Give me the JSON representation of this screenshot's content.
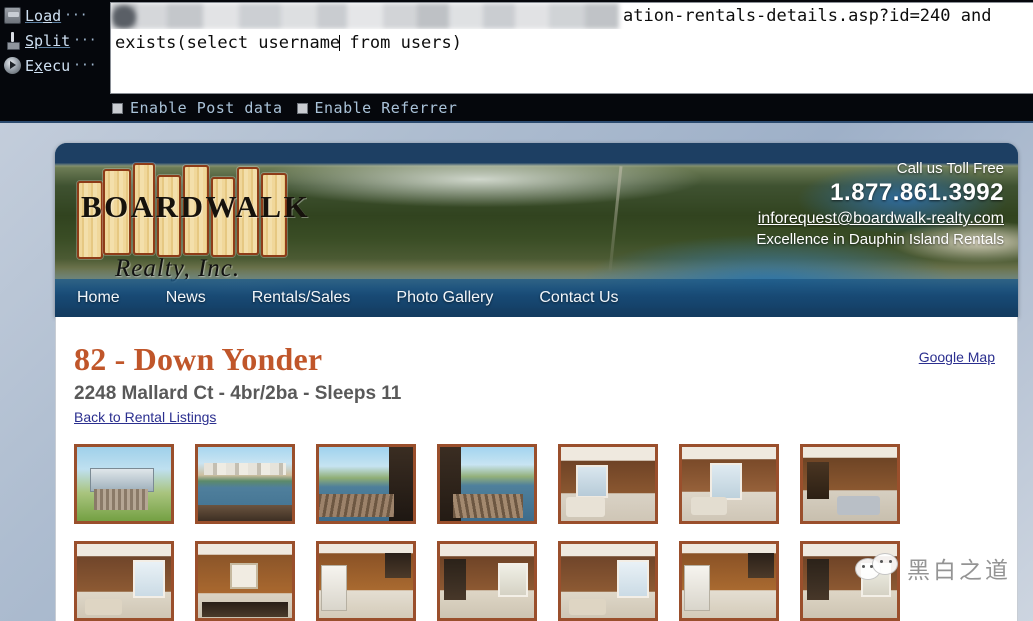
{
  "tool": {
    "menu": [
      {
        "id": "load",
        "label": "Load",
        "accel_index": 2,
        "dots": "···",
        "icon": "printer-icon"
      },
      {
        "id": "split",
        "label": "Split",
        "accel_index": 0,
        "dots": "···",
        "icon": "split-icon"
      },
      {
        "id": "execute",
        "label": "Execu",
        "accel_index": 1,
        "dots": "···",
        "icon": "play-icon"
      }
    ],
    "textarea": {
      "line1_redacted_prefix": "(redacted)",
      "line1_visible_suffix": "ation-rentals-details.asp?id=240 and",
      "line2": "exists(select username from users)"
    },
    "checkboxes": [
      {
        "id": "enable-post-data",
        "label": "Enable Post data",
        "checked": false
      },
      {
        "id": "enable-referrer",
        "label": "Enable Referrer",
        "checked": false
      }
    ]
  },
  "site": {
    "logo": {
      "word": "BOARDWALK",
      "subtitle": "Realty, Inc."
    },
    "contact": {
      "toll_free_label": "Call us Toll Free",
      "phone": "1.877.861.3992",
      "email": "inforequest@boardwalk-realty.com",
      "tagline": "Excellence in Dauphin Island Rentals"
    },
    "nav": [
      {
        "id": "home",
        "label": "Home"
      },
      {
        "id": "news",
        "label": "News"
      },
      {
        "id": "rentals-sales",
        "label": "Rentals/Sales"
      },
      {
        "id": "photo-gallery",
        "label": "Photo Gallery"
      },
      {
        "id": "contact-us",
        "label": "Contact Us"
      }
    ],
    "property": {
      "title": "82 - Down Yonder",
      "subtitle": "2248 Mallard Ct - 4br/2ba - Sleeps 11",
      "back_link": "Back to Rental Listings",
      "google_map_link": "Google Map"
    },
    "thumbnails": {
      "row1": [
        {
          "id": "thumb-exterior-stilt-house",
          "alt": "Exterior stilt house with stairs",
          "scene": "sc-ext1"
        },
        {
          "id": "thumb-canal-view-houses",
          "alt": "Canal with waterfront houses",
          "scene": "sc-canal"
        },
        {
          "id": "thumb-deck-canal-view-1",
          "alt": "Deck view over canal",
          "scene": "sc-deck"
        },
        {
          "id": "thumb-deck-canal-view-2",
          "alt": "Deck view over canal 2",
          "scene": "sc-deck2"
        },
        {
          "id": "thumb-living-room-1",
          "alt": "Living room wood panel",
          "scene": "sc-liv1"
        },
        {
          "id": "thumb-living-room-2",
          "alt": "Living room with sofa",
          "scene": "sc-liv2"
        },
        {
          "id": "thumb-living-room-3",
          "alt": "Living room toward kitchen",
          "scene": "sc-liv3"
        }
      ],
      "row2": [
        {
          "id": "thumb-bedroom-1",
          "alt": "Bedroom wood panel",
          "scene": "sc-bed1"
        },
        {
          "id": "thumb-kitchen-1",
          "alt": "Kitchen dining area",
          "scene": "sc-kit1"
        },
        {
          "id": "thumb-kitchen-2",
          "alt": "Kitchen with fridge",
          "scene": "sc-kit2"
        },
        {
          "id": "thumb-bedroom-2",
          "alt": "Bedroom with door",
          "scene": "sc-bed2"
        },
        {
          "id": "thumb-bedroom-3",
          "alt": "Bedroom with window",
          "scene": "sc-bed1"
        },
        {
          "id": "thumb-hallway-1",
          "alt": "Hallway wood panel",
          "scene": "sc-kit2"
        },
        {
          "id": "thumb-bedroom-4",
          "alt": "Bedroom corner",
          "scene": "sc-bed2"
        }
      ]
    }
  },
  "watermark": {
    "text": "黑白之道"
  },
  "colors": {
    "toolbar_bg": "#05070c",
    "toolbar_text": "#a9c2d8",
    "page_bg_start": "#c3cddb",
    "page_bg_end": "#cdd5e0",
    "nav_bg": "#16466f",
    "title_orange": "#c0562a",
    "subtitle_grey": "#595959",
    "link_blue": "#2b2f8f",
    "thumb_border": "#9a4f2c"
  }
}
